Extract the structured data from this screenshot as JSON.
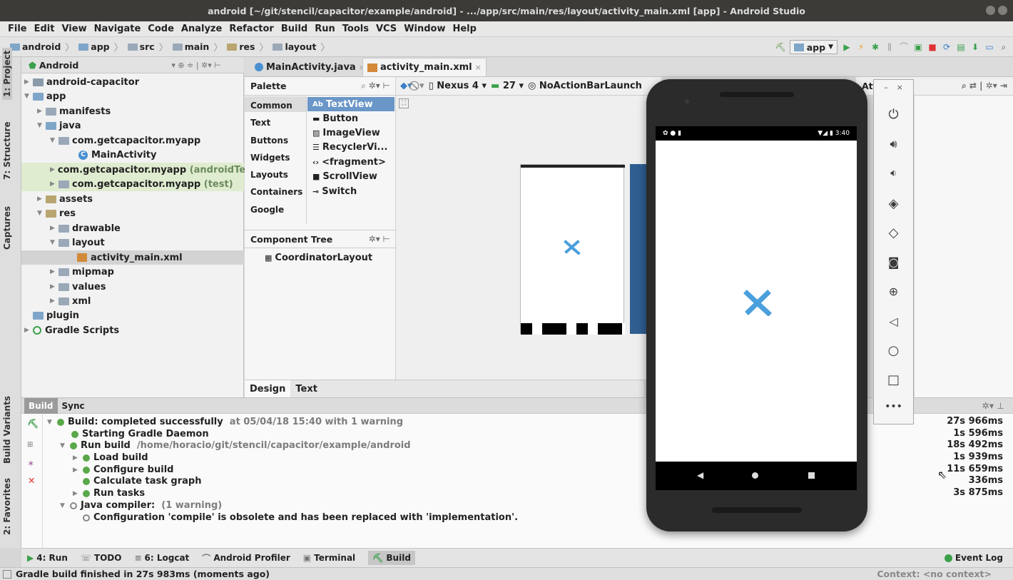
{
  "window": {
    "title": "android [~/git/stencil/capacitor/example/android] - .../app/src/main/res/layout/activity_main.xml [app] - Android Studio"
  },
  "menu": [
    "File",
    "Edit",
    "View",
    "Navigate",
    "Code",
    "Analyze",
    "Refactor",
    "Build",
    "Run",
    "Tools",
    "VCS",
    "Window",
    "Help"
  ],
  "breadcrumbs": [
    "android",
    "app",
    "src",
    "main",
    "res",
    "layout"
  ],
  "run_config": "app",
  "left_tabs": {
    "project": "1: Project",
    "structure": "7: Structure",
    "captures": "Captures",
    "build_variants": "Build Variants",
    "favorites": "2: Favorites"
  },
  "project": {
    "view_mode": "Android",
    "tree": [
      {
        "label": "android-capacitor",
        "suffix": ""
      },
      {
        "label": "app",
        "suffix": ""
      },
      {
        "label": "manifests",
        "suffix": ""
      },
      {
        "label": "java",
        "suffix": ""
      },
      {
        "label": "com.getcapacitor.myapp",
        "suffix": ""
      },
      {
        "label": "MainActivity",
        "suffix": ""
      },
      {
        "label": "com.getcapacitor.myapp",
        "suffix": "(androidTe"
      },
      {
        "label": "com.getcapacitor.myapp",
        "suffix": "(test)"
      },
      {
        "label": "assets",
        "suffix": ""
      },
      {
        "label": "res",
        "suffix": ""
      },
      {
        "label": "drawable",
        "suffix": ""
      },
      {
        "label": "layout",
        "suffix": ""
      },
      {
        "label": "activity_main.xml",
        "suffix": ""
      },
      {
        "label": "mipmap",
        "suffix": ""
      },
      {
        "label": "values",
        "suffix": ""
      },
      {
        "label": "xml",
        "suffix": ""
      },
      {
        "label": "plugin",
        "suffix": ""
      },
      {
        "label": "Gradle Scripts",
        "suffix": ""
      }
    ]
  },
  "editor_tabs": [
    "MainActivity.java",
    "activity_main.xml"
  ],
  "palette": {
    "title": "Palette",
    "categories": [
      "Common",
      "Text",
      "Buttons",
      "Widgets",
      "Layouts",
      "Containers",
      "Google"
    ],
    "items": [
      "TextView",
      "Button",
      "ImageView",
      "RecyclerVi...",
      "<fragment>",
      "ScrollView",
      "Switch"
    ],
    "textview_prefix": "Ab"
  },
  "design_toolbar": {
    "device": "Nexus 4",
    "api": "27",
    "theme": "NoActionBarLaunch",
    "attributes": "Attributes"
  },
  "component_tree": {
    "title": "Component Tree",
    "root": "CoordinatorLayout"
  },
  "design_tabs": [
    "Design",
    "Text"
  ],
  "build": {
    "tabs": [
      "Build",
      "Sync"
    ],
    "lines": [
      {
        "text": "Build: completed successfully",
        "extra": "at 05/04/18 15:40   with 1 warning",
        "time": "27s 966ms"
      },
      {
        "text": "Starting Gradle Daemon",
        "extra": "",
        "time": "1s 596ms"
      },
      {
        "text": "Run build",
        "extra": "/home/horacio/git/stencil/capacitor/example/android",
        "time": "18s 492ms"
      },
      {
        "text": "Load build",
        "extra": "",
        "time": "1s 939ms"
      },
      {
        "text": "Configure build",
        "extra": "",
        "time": "11s 659ms"
      },
      {
        "text": "Calculate task graph",
        "extra": "",
        "time": "336ms"
      },
      {
        "text": "Run tasks",
        "extra": "",
        "time": "3s 875ms"
      },
      {
        "text": "Java compiler:",
        "extra": "(1 warning)",
        "time": ""
      },
      {
        "text": "Configuration 'compile' is obsolete and has been replaced with 'implementation'.",
        "extra": "",
        "time": ""
      }
    ]
  },
  "bottom_tools": {
    "run": "4: Run",
    "todo": "TODO",
    "logcat": "6: Logcat",
    "profiler": "Android Profiler",
    "terminal": "Terminal",
    "build": "Build",
    "event_log": "Event Log"
  },
  "status": {
    "message": "Gradle build finished in 27s 983ms (moments ago)",
    "context": "Context: <no context>"
  },
  "emulator": {
    "time": "3:40",
    "controls": [
      "power",
      "volume-up",
      "volume-down",
      "rotate-left",
      "rotate-right",
      "screenshot",
      "zoom",
      "back",
      "home",
      "overview",
      "more"
    ]
  },
  "colors": {
    "accent": "#4a9fdc",
    "titlebar": "#3c3b37",
    "selection": "#d3d3d3",
    "success": "#59a84a"
  }
}
